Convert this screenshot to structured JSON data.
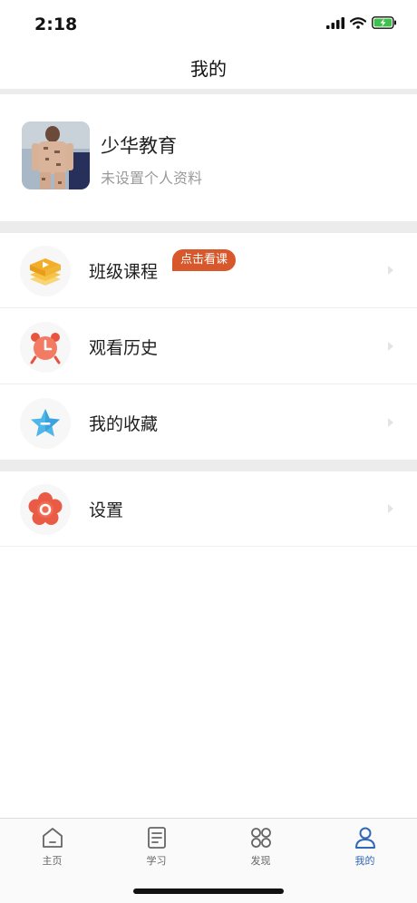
{
  "status": {
    "time": "2:18"
  },
  "nav": {
    "title": "我的"
  },
  "profile": {
    "name": "少华教育",
    "subtitle": "未设置个人资料"
  },
  "menu": {
    "items": [
      {
        "label": "班级课程",
        "icon": "video-course-icon",
        "badge": "点击看课"
      },
      {
        "label": "观看历史",
        "icon": "alarm-clock-icon"
      },
      {
        "label": "我的收藏",
        "icon": "star-icon"
      },
      {
        "label": "设置",
        "icon": "settings-flower-icon"
      }
    ]
  },
  "tabs": [
    {
      "label": "主页",
      "icon": "home-icon",
      "active": false
    },
    {
      "label": "学习",
      "icon": "document-icon",
      "active": false
    },
    {
      "label": "发现",
      "icon": "discover-grid-icon",
      "active": false
    },
    {
      "label": "我的",
      "icon": "person-icon",
      "active": true
    }
  ],
  "colors": {
    "accent": "#2f68b7",
    "badge": "#d8582b",
    "separator": "#ececec"
  }
}
